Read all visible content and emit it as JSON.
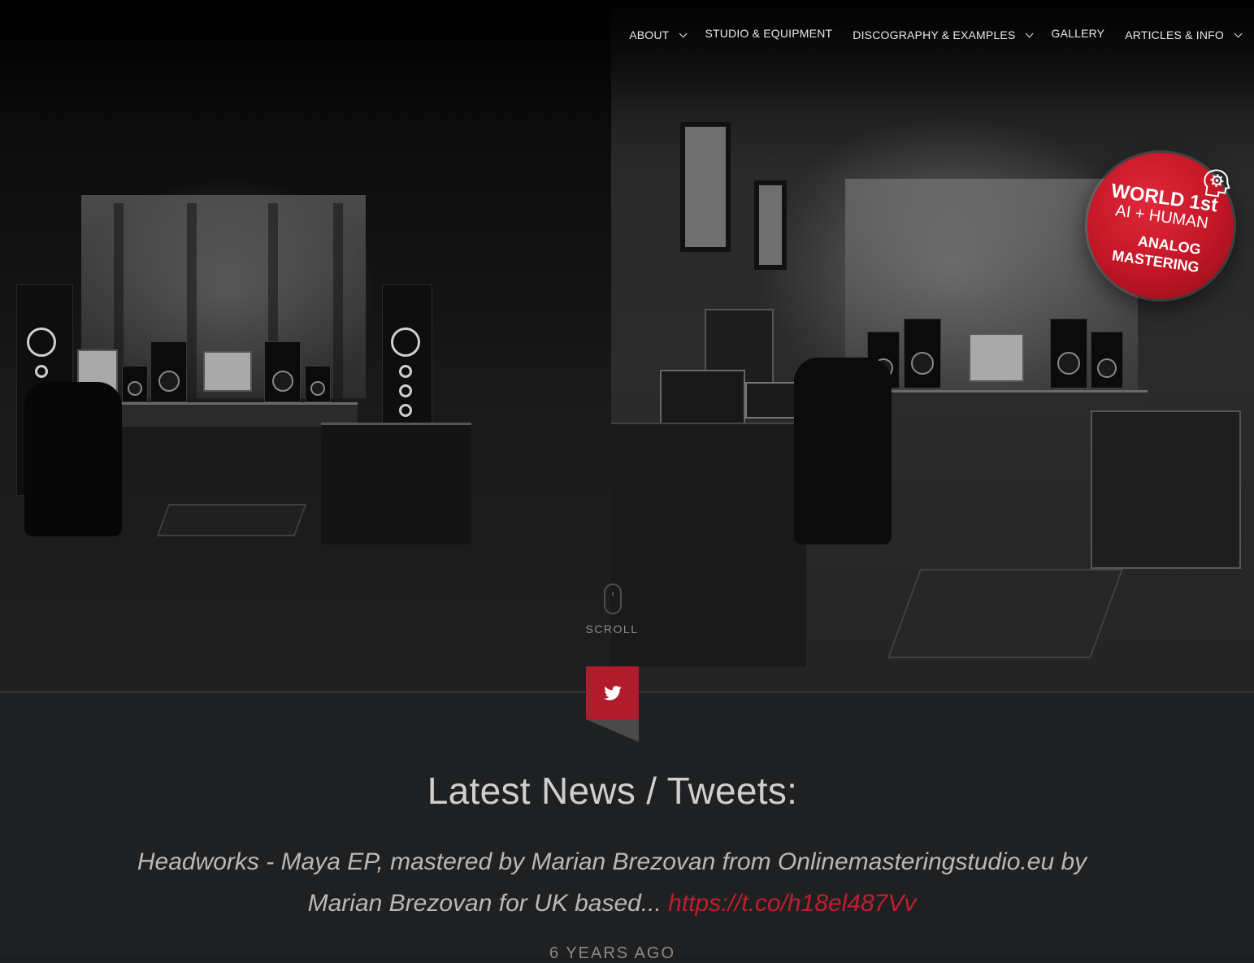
{
  "nav": {
    "items": [
      {
        "label": "ABOUT",
        "has_dropdown": true
      },
      {
        "label": "STUDIO & EQUIPMENT",
        "has_dropdown": false
      },
      {
        "label": "DISCOGRAPHY & EXAMPLES",
        "has_dropdown": true
      },
      {
        "label": "GALLERY",
        "has_dropdown": false
      },
      {
        "label": "ARTICLES & INFO",
        "has_dropdown": true
      }
    ]
  },
  "badge": {
    "line1": "WORLD 1st",
    "line2": "AI + HUMAN",
    "line3": "ANALOG",
    "line4": "MASTERING",
    "icon": "ai-head-gear-icon",
    "color": "#c11626"
  },
  "scroll": {
    "label": "SCROLL"
  },
  "news": {
    "title": "Latest News / Tweets:",
    "tweet_text": "Headworks - Maya EP, mastered by Marian Brezovan from Onlinemasteringstudio.eu by Marian Brezovan for UK based... ",
    "tweet_link": "https://t.co/h18el487Vv",
    "time_ago": "6 YEARS AGO",
    "icon": "twitter-icon",
    "accent_color": "#b01c2c",
    "link_color": "#c21e2f"
  }
}
